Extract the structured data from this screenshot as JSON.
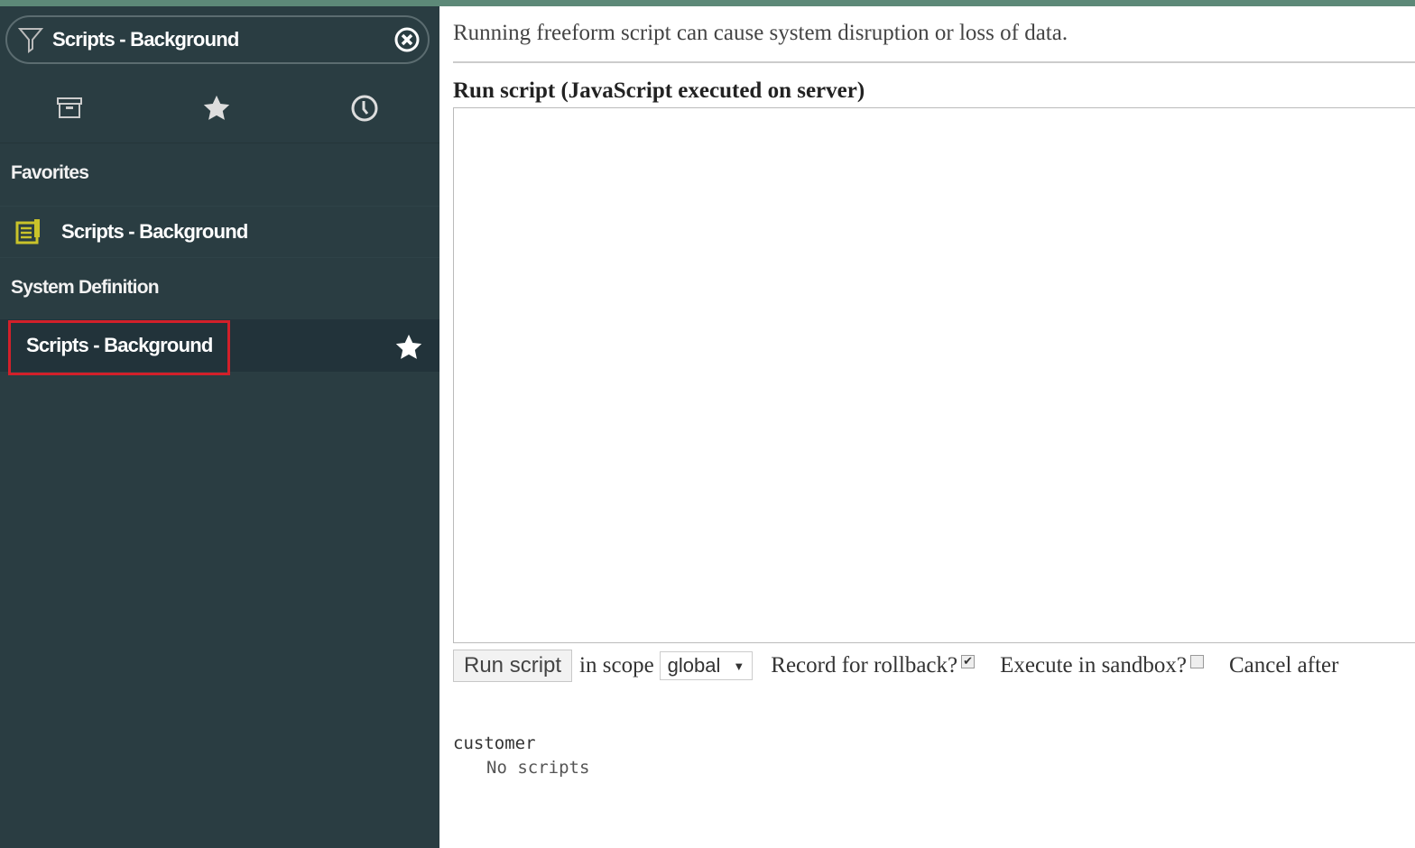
{
  "sidebar": {
    "filter_value": "Scripts - Background",
    "tabs": [
      "archive-icon",
      "star-icon",
      "clock-icon"
    ],
    "sections": [
      {
        "label": "Favorites",
        "items": [
          {
            "label": "Scripts - Background",
            "icon": "script-document-icon"
          }
        ]
      },
      {
        "label": "System Definition",
        "items": [
          {
            "label": "Scripts - Background",
            "icon": "star-icon"
          }
        ]
      }
    ],
    "highlight_color": "#d2202a"
  },
  "main": {
    "warning": "Running freeform script can cause system disruption or loss of data.",
    "heading": "Run script (JavaScript executed on server)",
    "script_value": "",
    "run_button": "Run script",
    "scope_label": "in scope",
    "scope_value": "global",
    "rollback_label": "Record for rollback?",
    "rollback_checked": true,
    "sandbox_label": "Execute in sandbox?",
    "sandbox_checked": false,
    "cancel_label": "Cancel after",
    "output_scope": "customer",
    "output_text": "No scripts"
  }
}
